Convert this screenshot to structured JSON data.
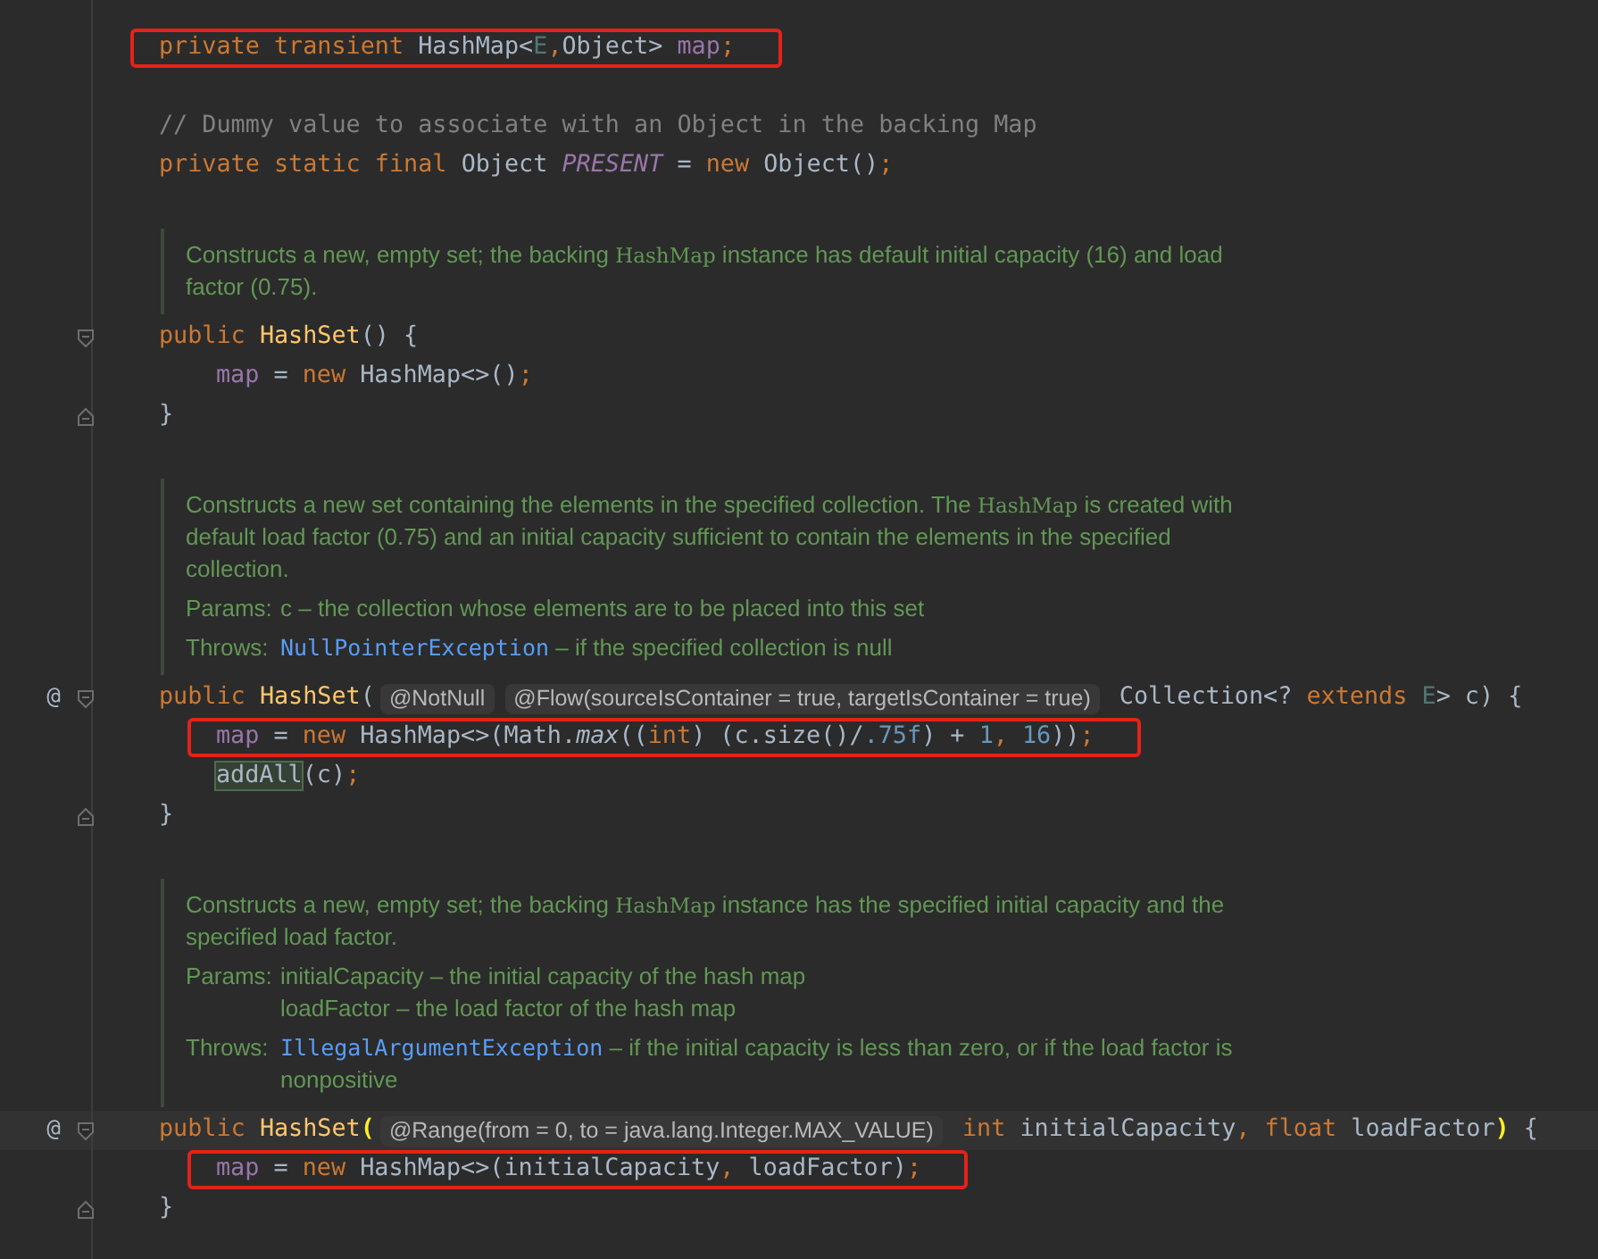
{
  "editor": {
    "lines": [
      {
        "kind": "code",
        "boxed": true,
        "tokens": [
          {
            "kind": "kw",
            "t": "private transient "
          },
          {
            "kind": "type",
            "t": "HashMap<"
          },
          {
            "kind": "tparam",
            "t": "E"
          },
          {
            "kind": "punct",
            "t": ","
          },
          {
            "kind": "type",
            "t": "Object> "
          },
          {
            "kind": "field",
            "t": "map"
          },
          {
            "kind": "punct",
            "t": ";"
          }
        ]
      },
      {
        "kind": "blank"
      },
      {
        "kind": "code",
        "tokens": [
          {
            "kind": "comment",
            "t": "// Dummy value to associate with an Object in the backing Map"
          }
        ]
      },
      {
        "kind": "code",
        "tokens": [
          {
            "kind": "kw",
            "t": "private static final "
          },
          {
            "kind": "type",
            "t": "Object "
          },
          {
            "kind": "sfield",
            "t": "PRESENT"
          },
          {
            "kind": "plain",
            "t": " = "
          },
          {
            "kind": "kw",
            "t": "new "
          },
          {
            "kind": "type",
            "t": "Object()"
          },
          {
            "kind": "punct",
            "t": ";"
          }
        ]
      },
      {
        "kind": "blank"
      },
      {
        "kind": "doc",
        "paragraph": [
          {
            "kind": "text",
            "t": "Constructs a new, empty set; the backing "
          },
          {
            "kind": "code",
            "t": "HashMap"
          },
          {
            "kind": "text",
            "t": " instance has default initial capacity (16) and load factor (0.75)."
          }
        ]
      },
      {
        "kind": "code",
        "fold_start": true,
        "tokens": [
          {
            "kind": "kw",
            "t": "public "
          },
          {
            "kind": "decl",
            "t": "HashSet"
          },
          {
            "kind": "plain",
            "t": "() {"
          }
        ]
      },
      {
        "kind": "code",
        "indented": true,
        "tokens": [
          {
            "kind": "field",
            "t": "map"
          },
          {
            "kind": "plain",
            "t": " = "
          },
          {
            "kind": "kw",
            "t": "new "
          },
          {
            "kind": "type",
            "t": "HashMap<>()"
          },
          {
            "kind": "punct",
            "t": ";"
          }
        ]
      },
      {
        "kind": "code",
        "fold_end": true,
        "tokens": [
          {
            "kind": "plain",
            "t": "}"
          }
        ]
      },
      {
        "kind": "blank"
      },
      {
        "kind": "doc",
        "paragraph": [
          {
            "kind": "text",
            "t": "Constructs a new set containing the elements in the specified collection. The "
          },
          {
            "kind": "code",
            "t": "HashMap"
          },
          {
            "kind": "text",
            "t": " is created with default load factor (0.75) and an initial capacity sufficient to contain the elements in the specified collection."
          }
        ],
        "sections": [
          {
            "label": "Params:",
            "items": [
              [
                {
                  "kind": "text",
                  "t": "c – the collection whose elements are to be placed into this set"
                }
              ]
            ]
          },
          {
            "label": "Throws:",
            "items": [
              [
                {
                  "kind": "link",
                  "t": "NullPointerException"
                },
                {
                  "kind": "text",
                  "t": " – if the specified collection is null"
                }
              ]
            ]
          }
        ]
      },
      {
        "kind": "code",
        "marker": "@",
        "fold_start": true,
        "tokens": [
          {
            "kind": "kw",
            "t": "public "
          },
          {
            "kind": "decl",
            "t": "HashSet"
          },
          {
            "kind": "plain",
            "t": "("
          },
          {
            "kind": "inlay",
            "t": "@NotNull"
          },
          {
            "kind": "inlay",
            "t": "@Flow(sourceIsContainer = true, targetIsContainer = true)"
          },
          {
            "kind": "type",
            "t": " Collection<? "
          },
          {
            "kind": "kw",
            "t": "extends "
          },
          {
            "kind": "tparam",
            "t": "E"
          },
          {
            "kind": "plain",
            "t": "> c) {"
          }
        ]
      },
      {
        "kind": "code",
        "boxed": true,
        "indented": true,
        "tokens": [
          {
            "kind": "field",
            "t": "map"
          },
          {
            "kind": "plain",
            "t": " = "
          },
          {
            "kind": "kw",
            "t": "new "
          },
          {
            "kind": "plain",
            "t": "HashMap<>(Math."
          },
          {
            "kind": "smethod",
            "t": "max"
          },
          {
            "kind": "plain",
            "t": "(("
          },
          {
            "kind": "kw",
            "t": "int"
          },
          {
            "kind": "plain",
            "t": ") (c.size()/"
          },
          {
            "kind": "num",
            "t": ".75f"
          },
          {
            "kind": "plain",
            "t": ") + "
          },
          {
            "kind": "num",
            "t": "1"
          },
          {
            "kind": "punct",
            "t": ", "
          },
          {
            "kind": "num",
            "t": "16"
          },
          {
            "kind": "plain",
            "t": "))"
          },
          {
            "kind": "punct",
            "t": ";"
          }
        ]
      },
      {
        "kind": "code",
        "indented": true,
        "tokens": [
          {
            "kind": "usage",
            "t": "addAll"
          },
          {
            "kind": "plain",
            "t": "(c)"
          },
          {
            "kind": "punct",
            "t": ";"
          }
        ]
      },
      {
        "kind": "code",
        "fold_end": true,
        "tokens": [
          {
            "kind": "plain",
            "t": "}"
          }
        ]
      },
      {
        "kind": "blank"
      },
      {
        "kind": "doc",
        "paragraph": [
          {
            "kind": "text",
            "t": "Constructs a new, empty set; the backing "
          },
          {
            "kind": "code",
            "t": "HashMap"
          },
          {
            "kind": "text",
            "t": " instance has the specified initial capacity and the specified load factor."
          }
        ],
        "sections": [
          {
            "label": "Params:",
            "items": [
              [
                {
                  "kind": "text",
                  "t": "initialCapacity – the initial capacity of the hash map"
                }
              ],
              [
                {
                  "kind": "text",
                  "t": "loadFactor – the load factor of the hash map"
                }
              ]
            ]
          },
          {
            "label": "Throws:",
            "items": [
              [
                {
                  "kind": "link",
                  "t": "IllegalArgumentException"
                },
                {
                  "kind": "text",
                  "t": " – if the initial capacity is less than zero, or if the load factor is nonpositive"
                }
              ]
            ]
          }
        ]
      },
      {
        "kind": "code",
        "marker": "@",
        "fold_start": true,
        "current": true,
        "tokens": [
          {
            "kind": "kw",
            "t": "public "
          },
          {
            "kind": "decl",
            "t": "HashSet"
          },
          {
            "kind": "brace",
            "t": "("
          },
          {
            "kind": "inlay",
            "t": "@Range(from = 0, to = java.lang.Integer.MAX_VALUE)"
          },
          {
            "kind": "kw",
            "t": " int "
          },
          {
            "kind": "plain",
            "t": "initialCapacity"
          },
          {
            "kind": "punct",
            "t": ", "
          },
          {
            "kind": "kw",
            "t": "float "
          },
          {
            "kind": "plain",
            "t": "loadFactor"
          },
          {
            "kind": "brace",
            "t": ")"
          },
          {
            "kind": "plain",
            "t": " {"
          }
        ]
      },
      {
        "kind": "code",
        "boxed": true,
        "indented": true,
        "tokens": [
          {
            "kind": "field",
            "t": "map"
          },
          {
            "kind": "plain",
            "t": " = "
          },
          {
            "kind": "kw",
            "t": "new "
          },
          {
            "kind": "plain",
            "t": "HashMap<>(initialCapacity"
          },
          {
            "kind": "punct",
            "t": ", "
          },
          {
            "kind": "plain",
            "t": "loadFactor)"
          },
          {
            "kind": "punct",
            "t": ";"
          }
        ]
      },
      {
        "kind": "code",
        "fold_end": true,
        "tokens": [
          {
            "kind": "plain",
            "t": "}"
          }
        ]
      }
    ]
  }
}
